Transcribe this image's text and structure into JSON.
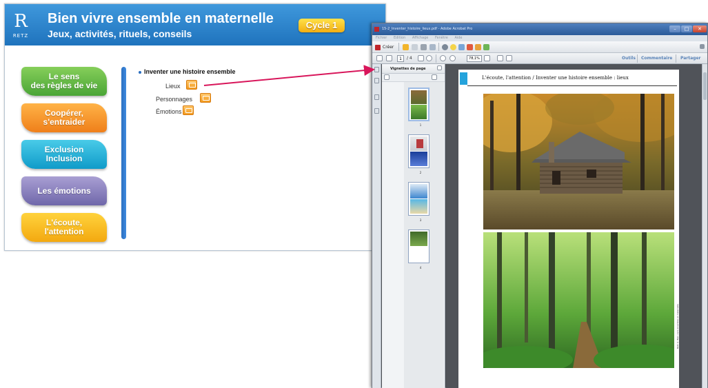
{
  "app": {
    "logo_letter": "R",
    "logo_text": "RETZ",
    "title": "Bien vivre ensemble en maternelle",
    "subtitle": "Jeux, activités, rituels, conseils",
    "cycle": "Cycle 1",
    "categories": [
      {
        "label": "Le sens\ndes règles de vie",
        "color": "#5cb842"
      },
      {
        "label": "Coopérer,\ns'entraider",
        "color": "#f28c28"
      },
      {
        "label": "Exclusion\nInclusion",
        "color": "#1fafd8"
      },
      {
        "label": "Les émotions",
        "color": "#8179bd"
      },
      {
        "label": "L'écoute,\nl'attention",
        "color": "#f7b51e"
      }
    ],
    "activity_title": "Inventer une histoire ensemble",
    "resources": [
      "Lieux",
      "Personnages",
      "Émotions"
    ]
  },
  "acrobat": {
    "window_title": "15-2_Inventer_histoire_lieux.pdf - Adobe Acrobat Pro",
    "menu": [
      "Fichier",
      "Edition",
      "Affichage",
      "Fenêtre",
      "Aide"
    ],
    "create_label": "Créer",
    "page_current": "1",
    "page_total": "/ 4",
    "zoom": "78,1%",
    "links": [
      "Outils",
      "Commentaire",
      "Partager"
    ],
    "thumbnails_title": "Vignettes de page",
    "thumb_labels": [
      "1",
      "2",
      "3",
      "4"
    ],
    "page_heading": "L'écoute, l'attention / Inventer une histoire ensemble : lieux",
    "credit": "Retz © Bien vivre ensemble en maternelle"
  },
  "colors": {
    "header_blue": "#2a84cf",
    "cycle_yellow": "#f7b51e",
    "arrow": "#d8155a",
    "page_tab": "#25a3dc"
  }
}
